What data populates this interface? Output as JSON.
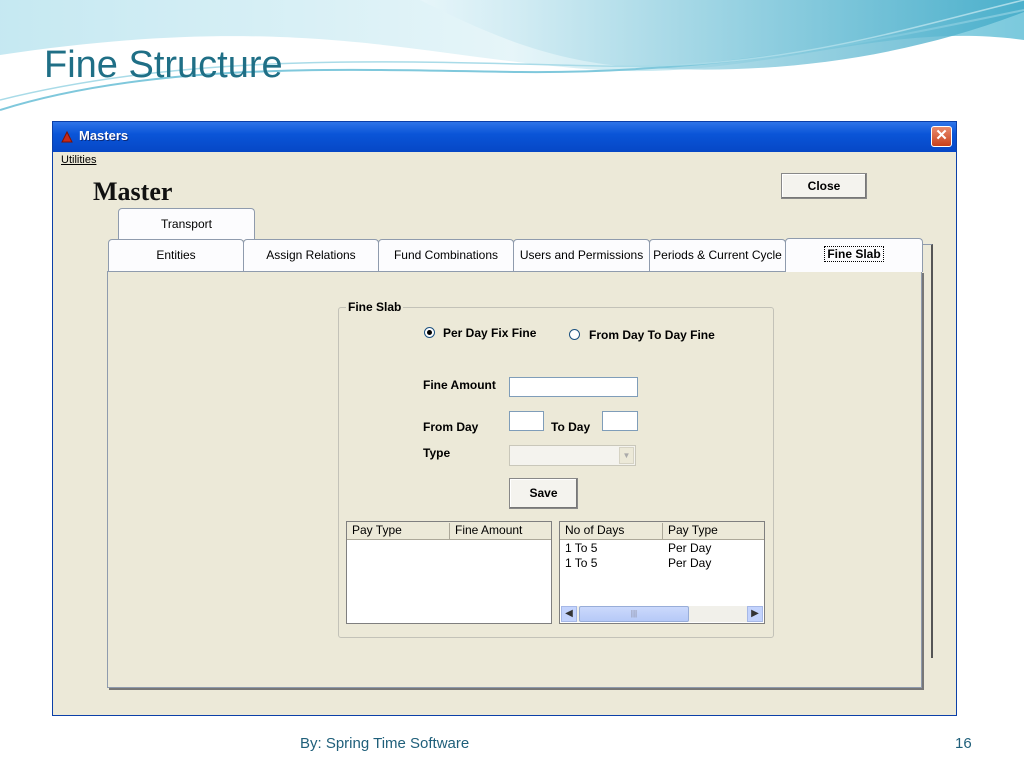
{
  "slide": {
    "title": "Fine Structure",
    "footer": "By: Spring Time Software",
    "page_number": "16"
  },
  "window": {
    "title": "Masters",
    "close_icon": "close-x-icon",
    "menu": {
      "utilities": "Utilities"
    }
  },
  "heading": "Master",
  "close_button": "Close",
  "tabs": {
    "top_row": [
      "Transport"
    ],
    "bottom_row": [
      "Entities",
      "Assign Relations",
      "Fund Combinations",
      "Users and Permissions",
      "Periods & Current Cycle",
      "Fine Slab"
    ],
    "active": "Fine Slab"
  },
  "fine_slab": {
    "group_title": "Fine Slab",
    "radio_per_day": "Per Day Fix Fine",
    "radio_day_to_day": "From Day To Day Fine",
    "selected_radio": "Per Day Fix Fine",
    "fine_amount_label": "Fine Amount",
    "fine_amount_value": "",
    "from_day_label": "From Day",
    "from_day_value": "",
    "to_day_label": "To Day",
    "to_day_value": "",
    "type_label": "Type",
    "type_value": "",
    "save_label": "Save"
  },
  "list_left": {
    "columns": [
      "Pay Type",
      "Fine Amount"
    ],
    "rows": []
  },
  "list_right": {
    "columns": [
      "No of Days",
      "Pay Type"
    ],
    "rows": [
      [
        "1 To 5",
        "Per Day"
      ],
      [
        "1 To 5",
        "Per Day"
      ]
    ]
  },
  "colors": {
    "title_color": "#1f6f86",
    "window_frame": "#0a55d8",
    "window_face": "#ece9d8"
  }
}
